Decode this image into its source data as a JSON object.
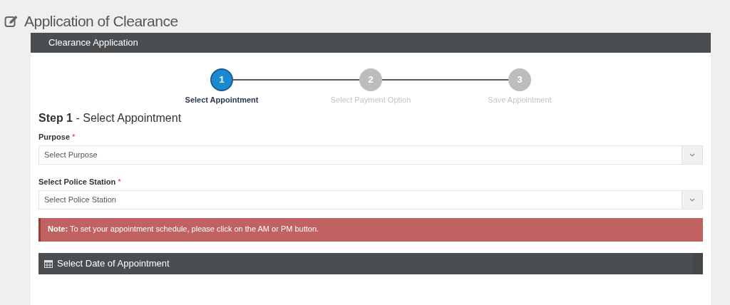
{
  "page_title": "Application of Clearance",
  "panel": {
    "title": "Clearance Application"
  },
  "steps": [
    {
      "number": "1",
      "label": "Select Appointment",
      "selected": true
    },
    {
      "number": "2",
      "label": "Select Payment Option",
      "selected": false
    },
    {
      "number": "3",
      "label": "Save Appointment",
      "selected": false
    }
  ],
  "step_heading": "**Step 1** - Select Appointment",
  "fields": [
    {
      "label": "Purpose",
      "required_mark": "*",
      "placeholder": "Select Purpose"
    },
    {
      "label": "Select Police Station",
      "required_mark": "*",
      "placeholder": "Select Police Station"
    }
  ],
  "note": "**Note:** To set your appointment schedule, please click on the AM or PM button.",
  "date_section": {
    "title": "Select Date of Appointment"
  }
}
